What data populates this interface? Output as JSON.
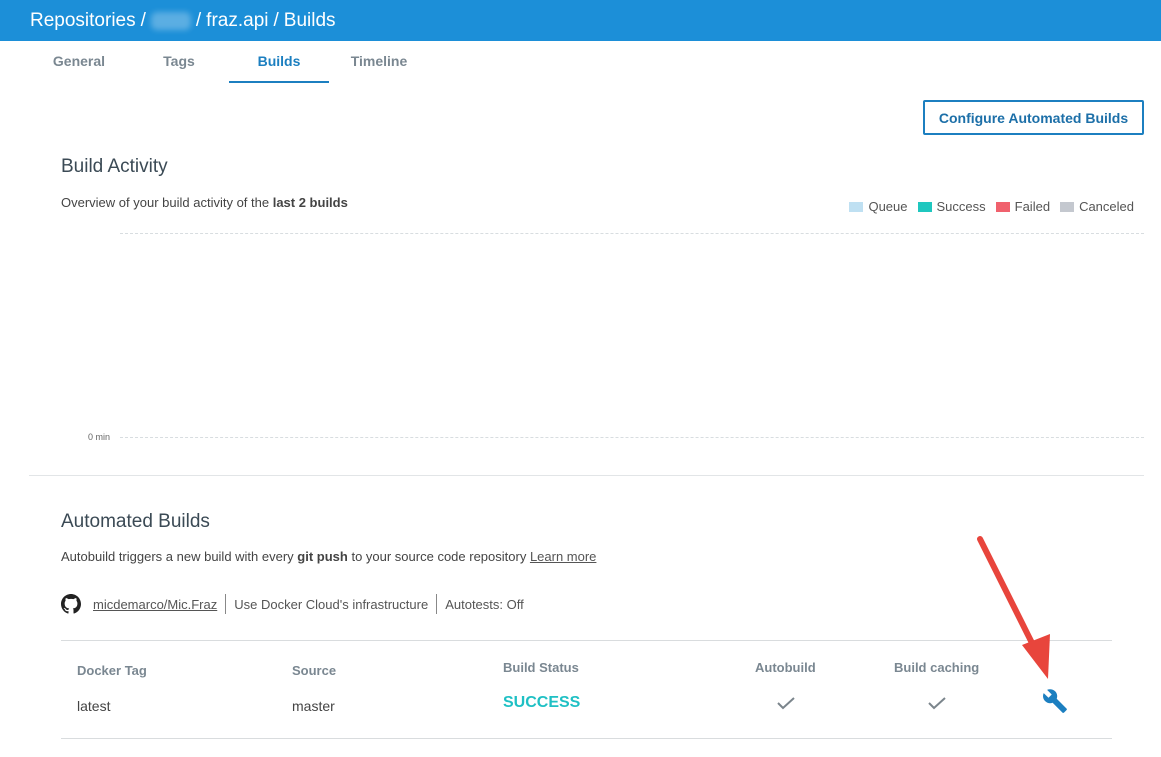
{
  "breadcrumb": {
    "root": "Repositories",
    "separator": "/",
    "namespace": "",
    "repo": "fraz.api",
    "page": "Builds"
  },
  "tabs": [
    {
      "label": "General",
      "active": false
    },
    {
      "label": "Tags",
      "active": false
    },
    {
      "label": "Builds",
      "active": true
    },
    {
      "label": "Timeline",
      "active": false
    }
  ],
  "configure_button": "Configure Automated Builds",
  "build_activity": {
    "title": "Build Activity",
    "desc_prefix": "Overview of your build activity of the ",
    "desc_bold": "last 2 builds",
    "axis_zero": "0 min",
    "legend": [
      {
        "label": "Queue",
        "color": "#bfe0f2"
      },
      {
        "label": "Success",
        "color": "#1fc7bf"
      },
      {
        "label": "Failed",
        "color": "#f0616d"
      },
      {
        "label": "Canceled",
        "color": "#c4c8cf"
      }
    ]
  },
  "automated_builds": {
    "title": "Automated Builds",
    "desc_prefix": "Autobuild triggers a new build with every ",
    "desc_bold": "git push",
    "desc_suffix": " to your source code repository ",
    "learn_more": "Learn more",
    "repo_link": "micdemarco/Mic.Fraz",
    "infrastructure": "Use Docker Cloud's infrastructure",
    "autotests": "Autotests: Off",
    "columns": {
      "docker_tag": "Docker Tag",
      "source": "Source",
      "build_status": "Build Status",
      "autobuild": "Autobuild",
      "build_caching": "Build caching"
    },
    "rows": [
      {
        "docker_tag": "latest",
        "source": "master",
        "build_status": "SUCCESS",
        "autobuild": true,
        "build_caching": true
      }
    ]
  },
  "colors": {
    "header": "#1c8fd8",
    "accent": "#1c7fc0",
    "success": "#1fc0c4",
    "annotation_arrow": "#e8453c"
  },
  "icons": [
    "github-icon",
    "checkmark-icon",
    "wrench-icon",
    "red-arrow-annotation"
  ]
}
